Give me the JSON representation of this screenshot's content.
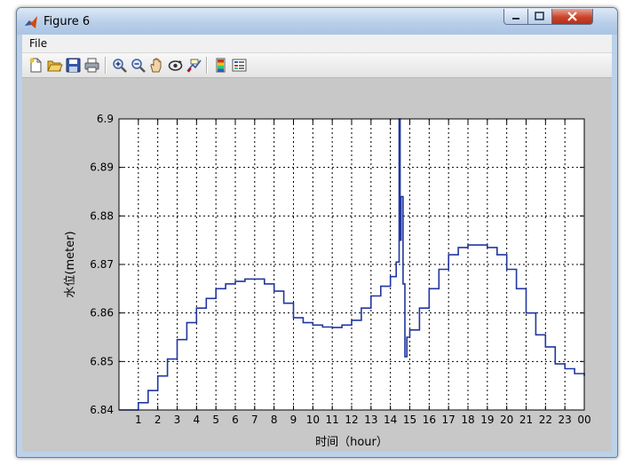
{
  "window": {
    "title": "Figure 6",
    "menu": {
      "file_label": "File"
    },
    "toolbar_icons": [
      "new-figure-icon",
      "open-file-icon",
      "save-icon",
      "print-icon",
      "zoom-in-icon",
      "zoom-out-icon",
      "pan-hand-icon",
      "rotate-3d-icon",
      "data-cursor-icon",
      "colorbar-icon",
      "legend-icon"
    ]
  },
  "colors": {
    "line": "#2136a0",
    "axes_bg": "#ffffff",
    "figure_bg": "#c8c8c8"
  },
  "chart_data": {
    "type": "line",
    "title": "",
    "xlabel": "时间（hour）",
    "ylabel": "水位(meter)",
    "xlim": [
      0,
      24
    ],
    "ylim": [
      6.84,
      6.9
    ],
    "x_tick_labels": [
      "1",
      "2",
      "3",
      "4",
      "5",
      "6",
      "7",
      "8",
      "9",
      "10",
      "11",
      "12",
      "13",
      "14",
      "15",
      "16",
      "17",
      "18",
      "19",
      "20",
      "21",
      "22",
      "23",
      "00"
    ],
    "y_tick_labels": [
      "6.84",
      "6.85",
      "6.86",
      "6.87",
      "6.88",
      "6.89",
      "6.9"
    ],
    "grid": true,
    "grid_style": "dotted",
    "step_plot": true,
    "series": [
      {
        "x": [
          0,
          0.5,
          1,
          1.5,
          2,
          2.5,
          3,
          3.5,
          4,
          4.5,
          5,
          5.5,
          6,
          6.5,
          7,
          7.5,
          8,
          8.5,
          9,
          9.5,
          10,
          10.5,
          11,
          11.5,
          12,
          12.5,
          13,
          13.5,
          14,
          14.3,
          14.45,
          14.5,
          14.55,
          14.65,
          14.75,
          14.85,
          15,
          15.5,
          16,
          16.5,
          17,
          17.5,
          18,
          18.5,
          19,
          19.5,
          20,
          20.5,
          21,
          21.5,
          22,
          22.5,
          23,
          23.5,
          24
        ],
        "y": [
          6.84,
          6.84,
          6.8415,
          6.844,
          6.847,
          6.8505,
          6.8545,
          6.858,
          6.861,
          6.863,
          6.865,
          6.866,
          6.8665,
          6.867,
          6.867,
          6.866,
          6.8645,
          6.862,
          6.859,
          6.858,
          6.8575,
          6.8571,
          6.857,
          6.8575,
          6.8585,
          6.861,
          6.8635,
          6.8655,
          6.8675,
          6.8705,
          6.9,
          6.875,
          6.884,
          6.866,
          6.851,
          6.855,
          6.8565,
          6.861,
          6.865,
          6.869,
          6.872,
          6.8735,
          6.874,
          6.874,
          6.8735,
          6.872,
          6.869,
          6.865,
          6.86,
          6.8555,
          6.853,
          6.8495,
          6.8485,
          6.8475,
          6.847
        ]
      }
    ]
  }
}
